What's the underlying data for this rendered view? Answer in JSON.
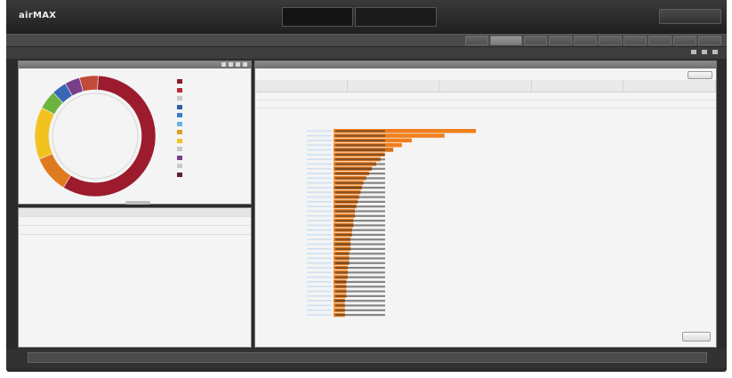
{
  "app": {
    "logo": "airMAX",
    "logo_sub": "",
    "device_line1": "",
    "device_line2": "",
    "device_info": "",
    "logout_label": ""
  },
  "nav": {
    "left_text": "",
    "tabs": [
      {
        "label": "",
        "active": false
      },
      {
        "label": "",
        "active": true
      },
      {
        "label": "",
        "active": false
      },
      {
        "label": "",
        "active": false
      },
      {
        "label": "",
        "active": false
      },
      {
        "label": "",
        "active": false
      },
      {
        "label": "",
        "active": false
      },
      {
        "label": "",
        "active": false
      },
      {
        "label": "",
        "active": false
      },
      {
        "label": "",
        "active": false
      }
    ]
  },
  "toolbar": {
    "breadcrumb": "",
    "right_text": ""
  },
  "left_panel": {
    "title": "",
    "center_lines": [
      "",
      "",
      "",
      "",
      "",
      ""
    ],
    "legend": [
      {
        "label": "",
        "color": "#8b1a2b"
      },
      {
        "label": "",
        "color": "#b82b3b"
      },
      {
        "label": "",
        "color": "#c9c9c9"
      },
      {
        "label": "",
        "color": "#2c5fa8"
      },
      {
        "label": "",
        "color": "#3d7cc9"
      },
      {
        "label": "",
        "color": "#6bb1e1"
      },
      {
        "label": "",
        "color": "#e39b2a"
      },
      {
        "label": "",
        "color": "#f2c320"
      },
      {
        "label": "",
        "color": "#c9c9c9"
      },
      {
        "label": "",
        "color": "#7a3d8c"
      },
      {
        "label": "",
        "color": "#c9c9c9"
      },
      {
        "label": "",
        "color": "#5a2230"
      }
    ],
    "donut_segments": [
      {
        "value": 58,
        "color": "#9c1c2e"
      },
      {
        "value": 10,
        "color": "#e07a1f"
      },
      {
        "value": 14,
        "color": "#f2c320"
      },
      {
        "value": 5,
        "color": "#6db33f"
      },
      {
        "value": 4,
        "color": "#3a66b8"
      },
      {
        "value": 4,
        "color": "#7a3d8c"
      },
      {
        "value": 5,
        "color": "#c24a3a"
      }
    ]
  },
  "bottom_left": {
    "header": "",
    "header_right": "",
    "rows": [
      {
        "label": "",
        "value": "",
        "extra": ""
      },
      {
        "label": "",
        "value": "",
        "extra": ""
      }
    ]
  },
  "right_panel": {
    "title": "",
    "columns": [
      "",
      "",
      "",
      "",
      ""
    ],
    "rows": [
      [
        "",
        "",
        "",
        "",
        ""
      ],
      [
        "",
        "",
        "",
        "",
        ""
      ]
    ],
    "chart_title": "",
    "chart_footer": "",
    "button_label": ""
  },
  "chart_data": {
    "type": "bar",
    "orientation": "horizontal",
    "categories": [
      "",
      "",
      "",
      "",
      "",
      "",
      "",
      "",
      "",
      "",
      "",
      "",
      "",
      "",
      "",
      "",
      "",
      "",
      "",
      "",
      "",
      "",
      "",
      "",
      "",
      "",
      "",
      "",
      "",
      "",
      "",
      "",
      "",
      "",
      "",
      "",
      "",
      "",
      "",
      ""
    ],
    "values": [
      100,
      78,
      55,
      48,
      42,
      36,
      33,
      30,
      27,
      25,
      23,
      21,
      20,
      19,
      18,
      17,
      16,
      15,
      15,
      14,
      14,
      13,
      13,
      12,
      12,
      12,
      11,
      11,
      11,
      10,
      10,
      10,
      9,
      9,
      9,
      9,
      8,
      8,
      8,
      8
    ],
    "colors": [
      "#f07e1b",
      "#f07e1b",
      "#f07e1b",
      "#f07e1b",
      "#9a9a9a"
    ],
    "xlim": [
      0,
      100
    ],
    "grid": false
  },
  "footer": {
    "left_text": "",
    "right_text": ""
  }
}
